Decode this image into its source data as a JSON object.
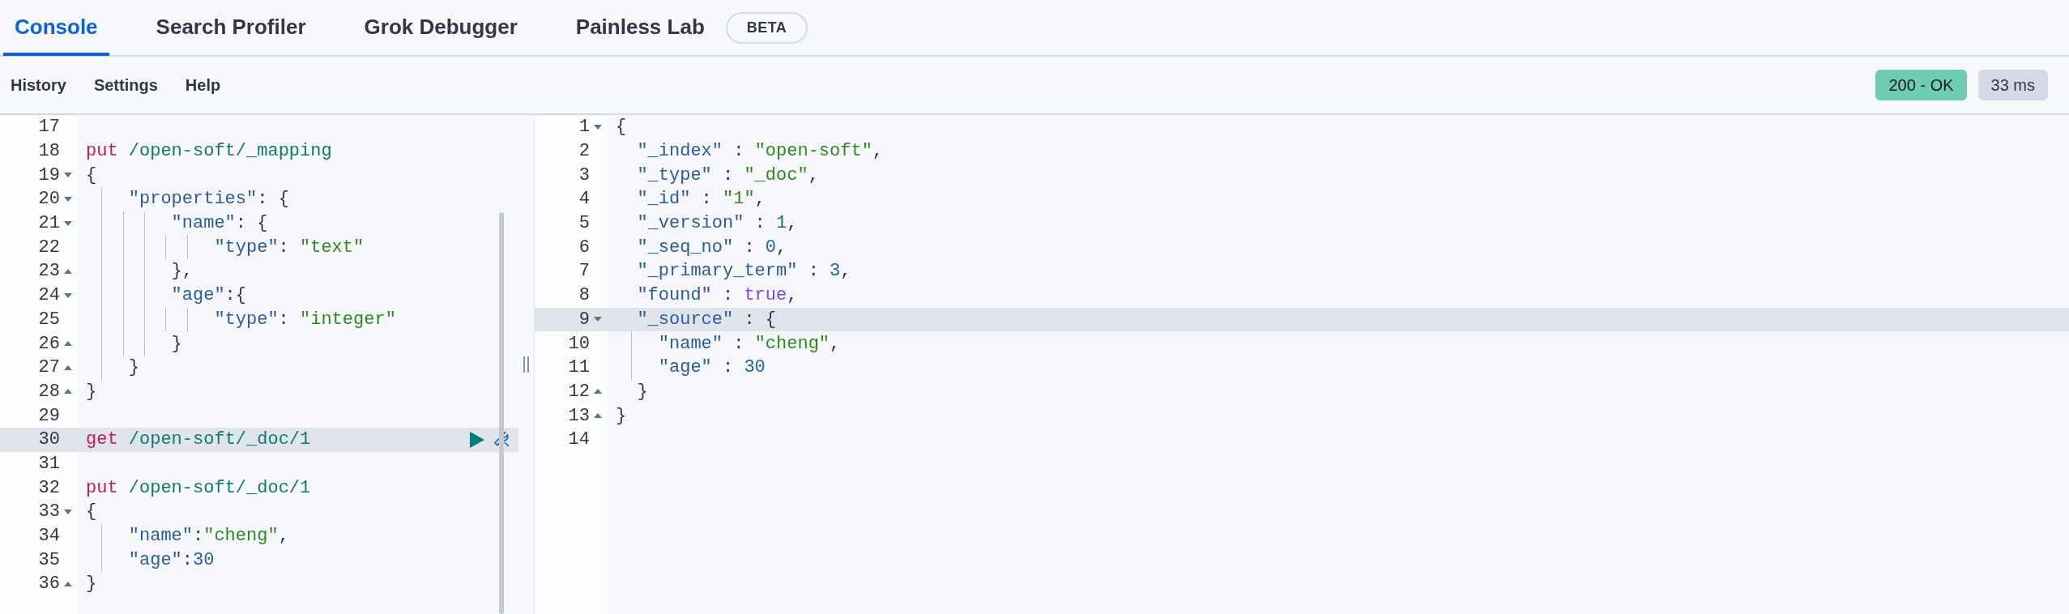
{
  "tabs": [
    {
      "label": "Console",
      "selected": true
    },
    {
      "label": "Search Profiler",
      "selected": false
    },
    {
      "label": "Grok Debugger",
      "selected": false
    },
    {
      "label": "Painless Lab",
      "selected": false,
      "badge": "BETA"
    }
  ],
  "toolbar": [
    "History",
    "Settings",
    "Help"
  ],
  "status": {
    "kind": "success",
    "label": "200 - OK",
    "time": "33 ms"
  },
  "request_editor": {
    "lines": [
      {
        "number": "17",
        "kind": "plain",
        "active": false
      },
      {
        "number": "18",
        "kind": "plain",
        "active": false,
        "tokens": [
          {
            "text": "put",
            "kind": "method"
          },
          {
            "text": " /open-soft/_mapping",
            "kind": "path"
          }
        ]
      },
      {
        "number": "19",
        "kind": "fold_start",
        "active": false,
        "tokens": [
          {
            "text": "{",
            "kind": "punct"
          }
        ]
      },
      {
        "number": "20",
        "kind": "fold_start",
        "active": false,
        "tokens": [
          {
            "text": "\"properties\"",
            "kind": "key"
          },
          {
            "text": ": {",
            "kind": "punct"
          }
        ]
      },
      {
        "number": "21",
        "kind": "fold_start",
        "active": false,
        "tokens": [
          {
            "text": "\"name\"",
            "kind": "key"
          },
          {
            "text": ": {",
            "kind": "punct"
          }
        ]
      },
      {
        "number": "22",
        "kind": "plain",
        "active": false,
        "tokens": [
          {
            "text": "\"type\"",
            "kind": "key"
          },
          {
            "text": ": ",
            "kind": "punct"
          },
          {
            "text": "\"text\"",
            "kind": "string"
          }
        ]
      },
      {
        "number": "23",
        "kind": "fold_end",
        "active": false,
        "tokens": [
          {
            "text": "},",
            "kind": "punct"
          }
        ]
      },
      {
        "number": "24",
        "kind": "fold_start",
        "active": false,
        "tokens": [
          {
            "text": "\"age\"",
            "kind": "key"
          },
          {
            "text": ":{",
            "kind": "punct"
          }
        ]
      },
      {
        "number": "25",
        "kind": "plain",
        "active": false,
        "tokens": [
          {
            "text": "\"type\"",
            "kind": "key"
          },
          {
            "text": ": ",
            "kind": "punct"
          },
          {
            "text": "\"integer\"",
            "kind": "string"
          }
        ]
      },
      {
        "number": "26",
        "kind": "fold_end",
        "active": false,
        "tokens": [
          {
            "text": "}",
            "kind": "punct"
          }
        ]
      },
      {
        "number": "27",
        "kind": "fold_end",
        "active": false,
        "tokens": [
          {
            "text": "}",
            "kind": "punct"
          }
        ]
      },
      {
        "number": "28",
        "kind": "fold_end",
        "active": false,
        "tokens": [
          {
            "text": "}",
            "kind": "punct"
          }
        ]
      },
      {
        "number": "29",
        "kind": "plain",
        "active": false
      },
      {
        "number": "30",
        "kind": "plain",
        "active": true,
        "tokens": [
          {
            "text": "get",
            "kind": "method"
          },
          {
            "text": " /open-soft/_doc/1",
            "kind": "path"
          }
        ]
      },
      {
        "number": "31",
        "kind": "plain",
        "active": false
      },
      {
        "number": "32",
        "kind": "plain",
        "active": false,
        "tokens": [
          {
            "text": "put",
            "kind": "method"
          },
          {
            "text": " /open-soft/_doc/1",
            "kind": "path"
          }
        ]
      },
      {
        "number": "33",
        "kind": "fold_start",
        "active": false,
        "tokens": [
          {
            "text": "{",
            "kind": "punct"
          }
        ]
      },
      {
        "number": "34",
        "kind": "plain",
        "active": false,
        "tokens": [
          {
            "text": "\"name\"",
            "kind": "key"
          },
          {
            "text": ":",
            "kind": "punct"
          },
          {
            "text": "\"cheng\"",
            "kind": "string"
          },
          {
            "text": ",",
            "kind": "punct"
          }
        ]
      },
      {
        "number": "35",
        "kind": "plain",
        "active": false,
        "tokens": [
          {
            "text": "\"age\"",
            "kind": "key"
          },
          {
            "text": ":",
            "kind": "punct"
          },
          {
            "text": "30",
            "kind": "number"
          }
        ]
      },
      {
        "number": "36",
        "kind": "fold_end",
        "active": false,
        "tokens": [
          {
            "text": "}",
            "kind": "punct"
          }
        ]
      }
    ]
  },
  "response_editor": {
    "lines": [
      {
        "number": "1",
        "kind": "fold_start",
        "active": false,
        "tokens": [
          {
            "text": "{",
            "kind": "punct"
          }
        ]
      },
      {
        "number": "2",
        "kind": "plain",
        "active": false,
        "tokens": [
          {
            "text": "\"_index\"",
            "kind": "key"
          },
          {
            "text": " : ",
            "kind": "punct"
          },
          {
            "text": "\"open-soft\"",
            "kind": "string"
          },
          {
            "text": ",",
            "kind": "punct"
          }
        ]
      },
      {
        "number": "3",
        "kind": "plain",
        "active": false,
        "tokens": [
          {
            "text": "\"_type\"",
            "kind": "key"
          },
          {
            "text": " : ",
            "kind": "punct"
          },
          {
            "text": "\"_doc\"",
            "kind": "string"
          },
          {
            "text": ",",
            "kind": "punct"
          }
        ]
      },
      {
        "number": "4",
        "kind": "plain",
        "active": false,
        "tokens": [
          {
            "text": "\"_id\"",
            "kind": "key"
          },
          {
            "text": " : ",
            "kind": "punct"
          },
          {
            "text": "\"1\"",
            "kind": "string"
          },
          {
            "text": ",",
            "kind": "punct"
          }
        ]
      },
      {
        "number": "5",
        "kind": "plain",
        "active": false,
        "tokens": [
          {
            "text": "\"_version\"",
            "kind": "key"
          },
          {
            "text": " : ",
            "kind": "punct"
          },
          {
            "text": "1",
            "kind": "number"
          },
          {
            "text": ",",
            "kind": "punct"
          }
        ]
      },
      {
        "number": "6",
        "kind": "plain",
        "active": false,
        "tokens": [
          {
            "text": "\"_seq_no\"",
            "kind": "key"
          },
          {
            "text": " : ",
            "kind": "punct"
          },
          {
            "text": "0",
            "kind": "number"
          },
          {
            "text": ",",
            "kind": "punct"
          }
        ]
      },
      {
        "number": "7",
        "kind": "plain",
        "active": false,
        "tokens": [
          {
            "text": "\"_primary_term\"",
            "kind": "key"
          },
          {
            "text": " : ",
            "kind": "punct"
          },
          {
            "text": "3",
            "kind": "number"
          },
          {
            "text": ",",
            "kind": "punct"
          }
        ]
      },
      {
        "number": "8",
        "kind": "plain",
        "active": false,
        "tokens": [
          {
            "text": "\"found\"",
            "kind": "key"
          },
          {
            "text": " : ",
            "kind": "punct"
          },
          {
            "text": "true",
            "kind": "boolean"
          },
          {
            "text": ",",
            "kind": "punct"
          }
        ]
      },
      {
        "number": "9",
        "kind": "fold_start",
        "active": true,
        "tokens": [
          {
            "text": "\"_source\"",
            "kind": "key"
          },
          {
            "text": " : {",
            "kind": "punct"
          }
        ]
      },
      {
        "number": "10",
        "kind": "plain",
        "active": false,
        "tokens": [
          {
            "text": "\"name\"",
            "kind": "key"
          },
          {
            "text": " : ",
            "kind": "punct"
          },
          {
            "text": "\"cheng\"",
            "kind": "string"
          },
          {
            "text": ",",
            "kind": "punct"
          }
        ]
      },
      {
        "number": "11",
        "kind": "plain",
        "active": false,
        "tokens": [
          {
            "text": "\"age\"",
            "kind": "key"
          },
          {
            "text": " : ",
            "kind": "punct"
          },
          {
            "text": "30",
            "kind": "number"
          }
        ]
      },
      {
        "number": "12",
        "kind": "fold_end",
        "active": false,
        "tokens": [
          {
            "text": "}",
            "kind": "punct"
          }
        ]
      },
      {
        "number": "13",
        "kind": "fold_end",
        "active": false,
        "tokens": [
          {
            "text": "}",
            "kind": "punct"
          }
        ]
      },
      {
        "number": "14",
        "kind": "plain",
        "active": false
      }
    ]
  }
}
